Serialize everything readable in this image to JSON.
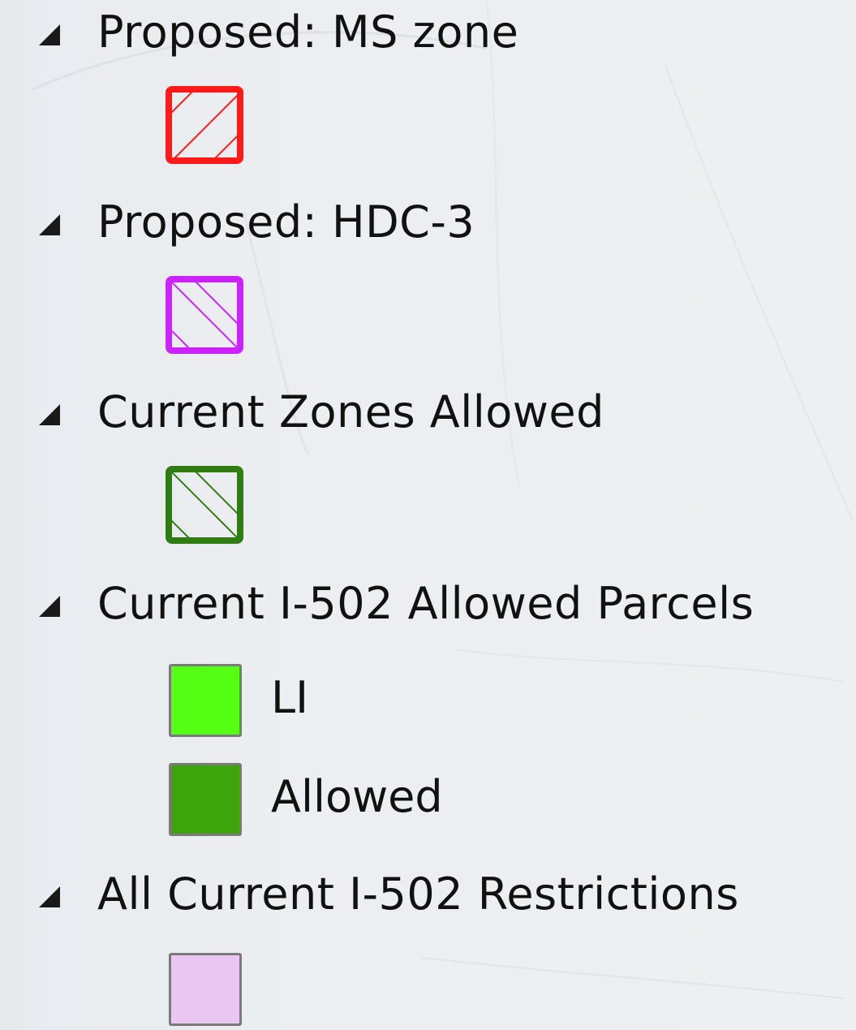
{
  "legend": {
    "layers": [
      {
        "title": "Proposed: MS zone",
        "expanded": true,
        "swatch": {
          "kind": "hatch",
          "color": "#ff1a1a",
          "direction": "forward"
        }
      },
      {
        "title": "Proposed: HDC-3",
        "expanded": true,
        "swatch": {
          "kind": "hatch",
          "color": "#cc22ff",
          "direction": "back"
        }
      },
      {
        "title": "Current Zones Allowed",
        "expanded": true,
        "swatch": {
          "kind": "hatch",
          "color": "#2f7d12",
          "direction": "back"
        }
      },
      {
        "title": "Current I-502 Allowed Parcels",
        "expanded": true,
        "classes": [
          {
            "label": "LI",
            "color": "#55ff14"
          },
          {
            "label": "Allowed",
            "color": "#3ea40c"
          }
        ]
      },
      {
        "title": "All Current I-502 Restrictions",
        "expanded": true,
        "swatch": {
          "kind": "solid",
          "color": "#eac6f3"
        }
      }
    ]
  }
}
